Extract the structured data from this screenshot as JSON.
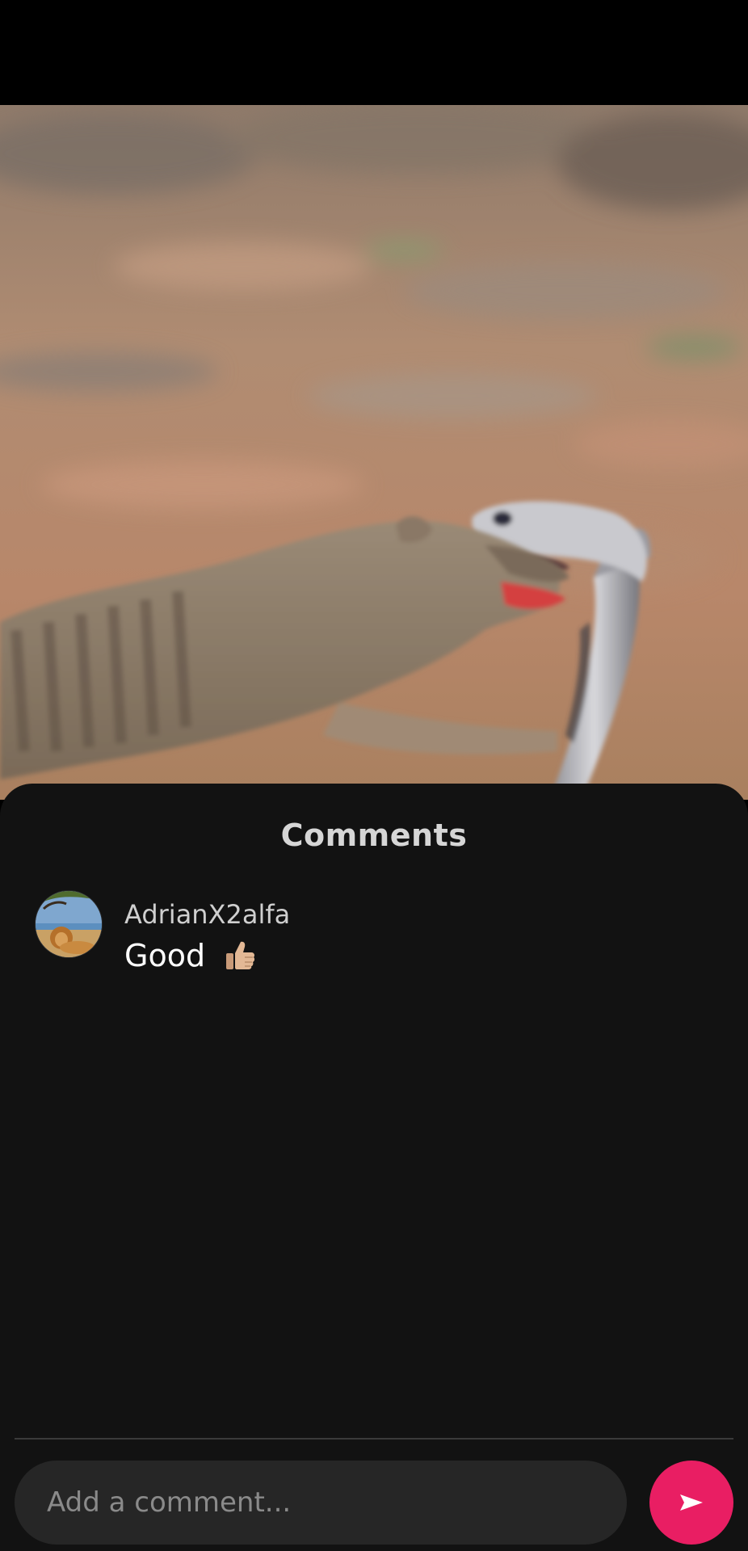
{
  "comments_sheet": {
    "title": "Comments",
    "comments": [
      {
        "username": "AdrianX2alfa",
        "text": "Good",
        "emoji_icon": "thumbs-up-icon",
        "avatar_icon": "lion-avatar-icon"
      }
    ],
    "input": {
      "placeholder": "Add a comment...",
      "value": ""
    },
    "send_icon": "send-arrow-icon"
  },
  "colors": {
    "sheet_background": "#121212",
    "input_background": "#262626",
    "send_button": "#e91e63",
    "title_text": "#d6d6d6",
    "username_text": "#cfcfcf",
    "comment_text": "#ffffff"
  }
}
